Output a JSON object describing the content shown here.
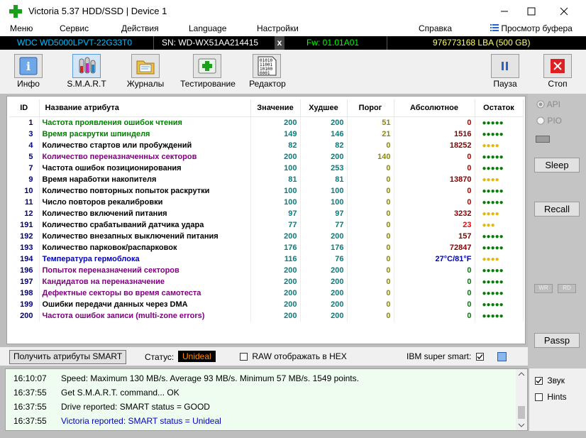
{
  "window": {
    "title": "Victoria 5.37 HDD/SSD | Device 1",
    "controls": {
      "minimize": "—",
      "maximize": "☐",
      "close": "✕"
    }
  },
  "menu": {
    "items": [
      "Меню",
      "Сервис",
      "Действия",
      "Language",
      "Настройки",
      "Справка"
    ],
    "buffer_view": "Просмотр буфера"
  },
  "device": {
    "model": "WDC WD5000LPVT-22G33T0",
    "serial": "SN: WD-WX51AA214415",
    "close_mark": "x",
    "firmware": "Fw: 01.01A01",
    "capacity": "976773168 LBA (500 GB)"
  },
  "toolbar": {
    "info": "Инфо",
    "smart": "S.M.A.R.T",
    "logs": "Журналы",
    "testing": "Тестирование",
    "editor": "Редактор",
    "pause": "Пауза",
    "stop": "Стоп",
    "editor_icon_text": "01010\n11001\n10100\n0001"
  },
  "table": {
    "headers": {
      "id": "ID",
      "name": "Название атрибута",
      "value": "Значение",
      "worst": "Худшее",
      "threshold": "Порог",
      "raw": "Абсолютное",
      "remain": "Остаток"
    },
    "rows": [
      {
        "id": "1",
        "name": "Частота проявления ошибок чтения",
        "value": "200",
        "worst": "200",
        "threshold": "51",
        "raw": "0",
        "dots": "●●●●●",
        "name_color": "#008000",
        "thr_color": "#8a8a00",
        "raw_color": "#c00000",
        "dot_color": "#008000"
      },
      {
        "id": "3",
        "name": "Время раскрутки шпинделя",
        "value": "149",
        "worst": "146",
        "threshold": "21",
        "raw": "1516",
        "dots": "●●●●●",
        "name_color": "#008000",
        "thr_color": "#8a8a00",
        "raw_color": "#8b0000",
        "dot_color": "#008000"
      },
      {
        "id": "4",
        "name": "Количество стартов или пробуждений",
        "value": "82",
        "worst": "82",
        "threshold": "0",
        "raw": "18252",
        "dots": "●●●●",
        "name_color": "#000000",
        "thr_color": "#8a8a00",
        "raw_color": "#8b0000",
        "dot_color": "#e6b800"
      },
      {
        "id": "5",
        "name": "Количество переназначенных секторов",
        "value": "200",
        "worst": "200",
        "threshold": "140",
        "raw": "0",
        "dots": "●●●●●",
        "name_color": "#800080",
        "thr_color": "#8a8a00",
        "raw_color": "#c00000",
        "dot_color": "#008000"
      },
      {
        "id": "7",
        "name": "Частота ошибок позиционирования",
        "value": "100",
        "worst": "253",
        "threshold": "0",
        "raw": "0",
        "dots": "●●●●●",
        "name_color": "#000000",
        "thr_color": "#8a8a00",
        "raw_color": "#c00000",
        "dot_color": "#008000"
      },
      {
        "id": "9",
        "name": "Время наработки накопителя",
        "value": "81",
        "worst": "81",
        "threshold": "0",
        "raw": "13870",
        "dots": "●●●●",
        "name_color": "#000000",
        "thr_color": "#8a8a00",
        "raw_color": "#8b0000",
        "dot_color": "#e6b800"
      },
      {
        "id": "10",
        "name": "Количество повторных попыток раскрутки",
        "value": "100",
        "worst": "100",
        "threshold": "0",
        "raw": "0",
        "dots": "●●●●●",
        "name_color": "#000000",
        "thr_color": "#8a8a00",
        "raw_color": "#c00000",
        "dot_color": "#008000"
      },
      {
        "id": "11",
        "name": "Число повторов рекалибровки",
        "value": "100",
        "worst": "100",
        "threshold": "0",
        "raw": "0",
        "dots": "●●●●●",
        "name_color": "#000000",
        "thr_color": "#8a8a00",
        "raw_color": "#c00000",
        "dot_color": "#008000"
      },
      {
        "id": "12",
        "name": "Количество включений питания",
        "value": "97",
        "worst": "97",
        "threshold": "0",
        "raw": "3232",
        "dots": "●●●●",
        "name_color": "#000000",
        "thr_color": "#8a8a00",
        "raw_color": "#8b0000",
        "dot_color": "#e6b800"
      },
      {
        "id": "191",
        "name": "Количество срабатываний датчика удара",
        "value": "77",
        "worst": "77",
        "threshold": "0",
        "raw": "23",
        "dots": "●●●",
        "name_color": "#000000",
        "thr_color": "#8a8a00",
        "raw_color": "#ff0000",
        "dot_color": "#e6b800"
      },
      {
        "id": "192",
        "name": "Количество внезапных выключений питания",
        "value": "200",
        "worst": "200",
        "threshold": "0",
        "raw": "157",
        "dots": "●●●●●",
        "name_color": "#000000",
        "thr_color": "#8a8a00",
        "raw_color": "#8b0000",
        "dot_color": "#008000"
      },
      {
        "id": "193",
        "name": "Количество парковок/распарковок",
        "value": "176",
        "worst": "176",
        "threshold": "0",
        "raw": "72847",
        "dots": "●●●●●",
        "name_color": "#000000",
        "thr_color": "#8a8a00",
        "raw_color": "#8b0000",
        "dot_color": "#008000"
      },
      {
        "id": "194",
        "name": "Температура гермоблока",
        "value": "116",
        "worst": "76",
        "threshold": "0",
        "raw": "27°C/81°F",
        "dots": "●●●●",
        "name_color": "#0000c0",
        "thr_color": "#8a8a00",
        "raw_color": "#0000c0",
        "dot_color": "#e6b800"
      },
      {
        "id": "196",
        "name": "Попыток переназначений секторов",
        "value": "200",
        "worst": "200",
        "threshold": "0",
        "raw": "0",
        "dots": "●●●●●",
        "name_color": "#800080",
        "thr_color": "#8a8a00",
        "raw_color": "#008000",
        "dot_color": "#008000"
      },
      {
        "id": "197",
        "name": "Кандидатов на переназначение",
        "value": "200",
        "worst": "200",
        "threshold": "0",
        "raw": "0",
        "dots": "●●●●●",
        "name_color": "#800080",
        "thr_color": "#8a8a00",
        "raw_color": "#008000",
        "dot_color": "#008000"
      },
      {
        "id": "198",
        "name": "Дефектные секторы во время самотеста",
        "value": "200",
        "worst": "200",
        "threshold": "0",
        "raw": "0",
        "dots": "●●●●●",
        "name_color": "#800080",
        "thr_color": "#8a8a00",
        "raw_color": "#008000",
        "dot_color": "#008000"
      },
      {
        "id": "199",
        "name": "Ошибки передачи данных через DMA",
        "value": "200",
        "worst": "200",
        "threshold": "0",
        "raw": "0",
        "dots": "●●●●●",
        "name_color": "#000000",
        "thr_color": "#8a8a00",
        "raw_color": "#008000",
        "dot_color": "#008000"
      },
      {
        "id": "200",
        "name": "Частота ошибок записи (multi-zone errors)",
        "value": "200",
        "worst": "200",
        "threshold": "0",
        "raw": "0",
        "dots": "●●●●●",
        "name_color": "#800080",
        "thr_color": "#8a8a00",
        "raw_color": "#008000",
        "dot_color": "#008000"
      }
    ]
  },
  "statusbar": {
    "get_button": "Получить атрибуты SMART",
    "status_label": "Статус:",
    "status_value": "Unideal",
    "raw_hex_label": "RAW отображать в HEX",
    "ibm_label": "IBM super smart:"
  },
  "rightpanel": {
    "api": "API",
    "pio": "PIO",
    "sleep": "Sleep",
    "recall": "Recall",
    "wr": "WR",
    "rd": "RD",
    "passp": "Passp"
  },
  "log": [
    {
      "time": "16:10:07",
      "msg": "Speed: Maximum 130 MB/s. Average 93 MB/s. Minimum 57 MB/s. 1549 points.",
      "color": "#000000"
    },
    {
      "time": "16:37:55",
      "msg": "Get S.M.A.R.T. command... OK",
      "color": "#000000"
    },
    {
      "time": "16:37:55",
      "msg": "Drive reported: SMART status = GOOD",
      "color": "#000000"
    },
    {
      "time": "16:37:55",
      "msg": "Victoria reported: SMART status = Unideal",
      "color": "#0000c0"
    }
  ],
  "bottompanel": {
    "sound": "Звук",
    "hints": "Hints"
  },
  "colors": {
    "value_color": "#008080",
    "titlebar_bg": "#ffffff",
    "device_bar_bg": "#000000",
    "device_model_color": "#00bfff",
    "device_fw_color": "#00ff00",
    "device_lba_color": "#ffff66",
    "status_value_bg": "#000000",
    "status_value_color": "#ff8c00"
  }
}
